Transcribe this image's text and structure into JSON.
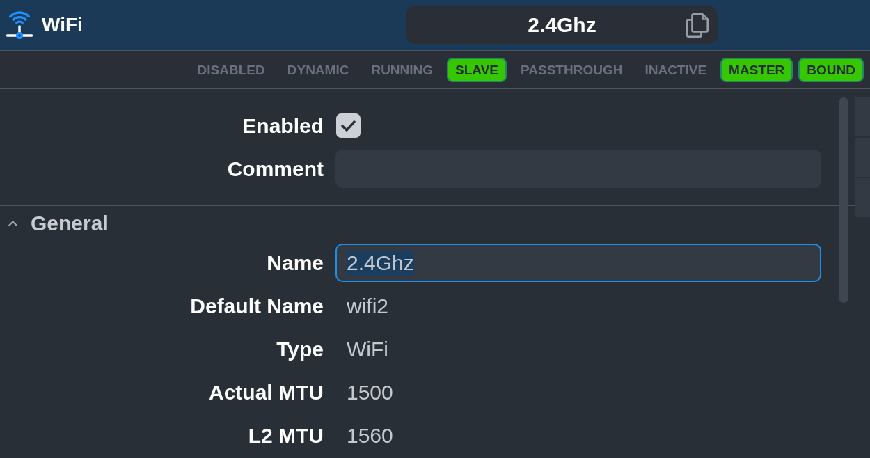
{
  "app_bar": {
    "title": "WiFi",
    "record_name": "2.4Ghz"
  },
  "flags": [
    {
      "label": "DISABLED",
      "active": false
    },
    {
      "label": "DYNAMIC",
      "active": false
    },
    {
      "label": "RUNNING",
      "active": false
    },
    {
      "label": "SLAVE",
      "active": true
    },
    {
      "label": "PASSTHROUGH",
      "active": false
    },
    {
      "label": "INACTIVE",
      "active": false
    },
    {
      "label": "MASTER",
      "active": true
    },
    {
      "label": "BOUND",
      "active": true
    }
  ],
  "fields": [
    {
      "kind": "checkbox",
      "label": "Enabled",
      "checked": true
    },
    {
      "kind": "input",
      "label": "Comment",
      "focused": false
    }
  ],
  "sections": [
    {
      "title": "General",
      "expanded": true,
      "fields": [
        {
          "kind": "input",
          "label": "Name",
          "value": "2.4Ghz",
          "focused": true,
          "text_selected": true
        },
        {
          "kind": "text",
          "label": "Default Name",
          "value": "wifi2"
        },
        {
          "kind": "text",
          "label": "Type",
          "value": "WiFi"
        },
        {
          "kind": "text",
          "label": "Actual MTU",
          "value": "1500"
        },
        {
          "kind": "text",
          "label": "L2 MTU",
          "value": "1560"
        }
      ]
    }
  ]
}
